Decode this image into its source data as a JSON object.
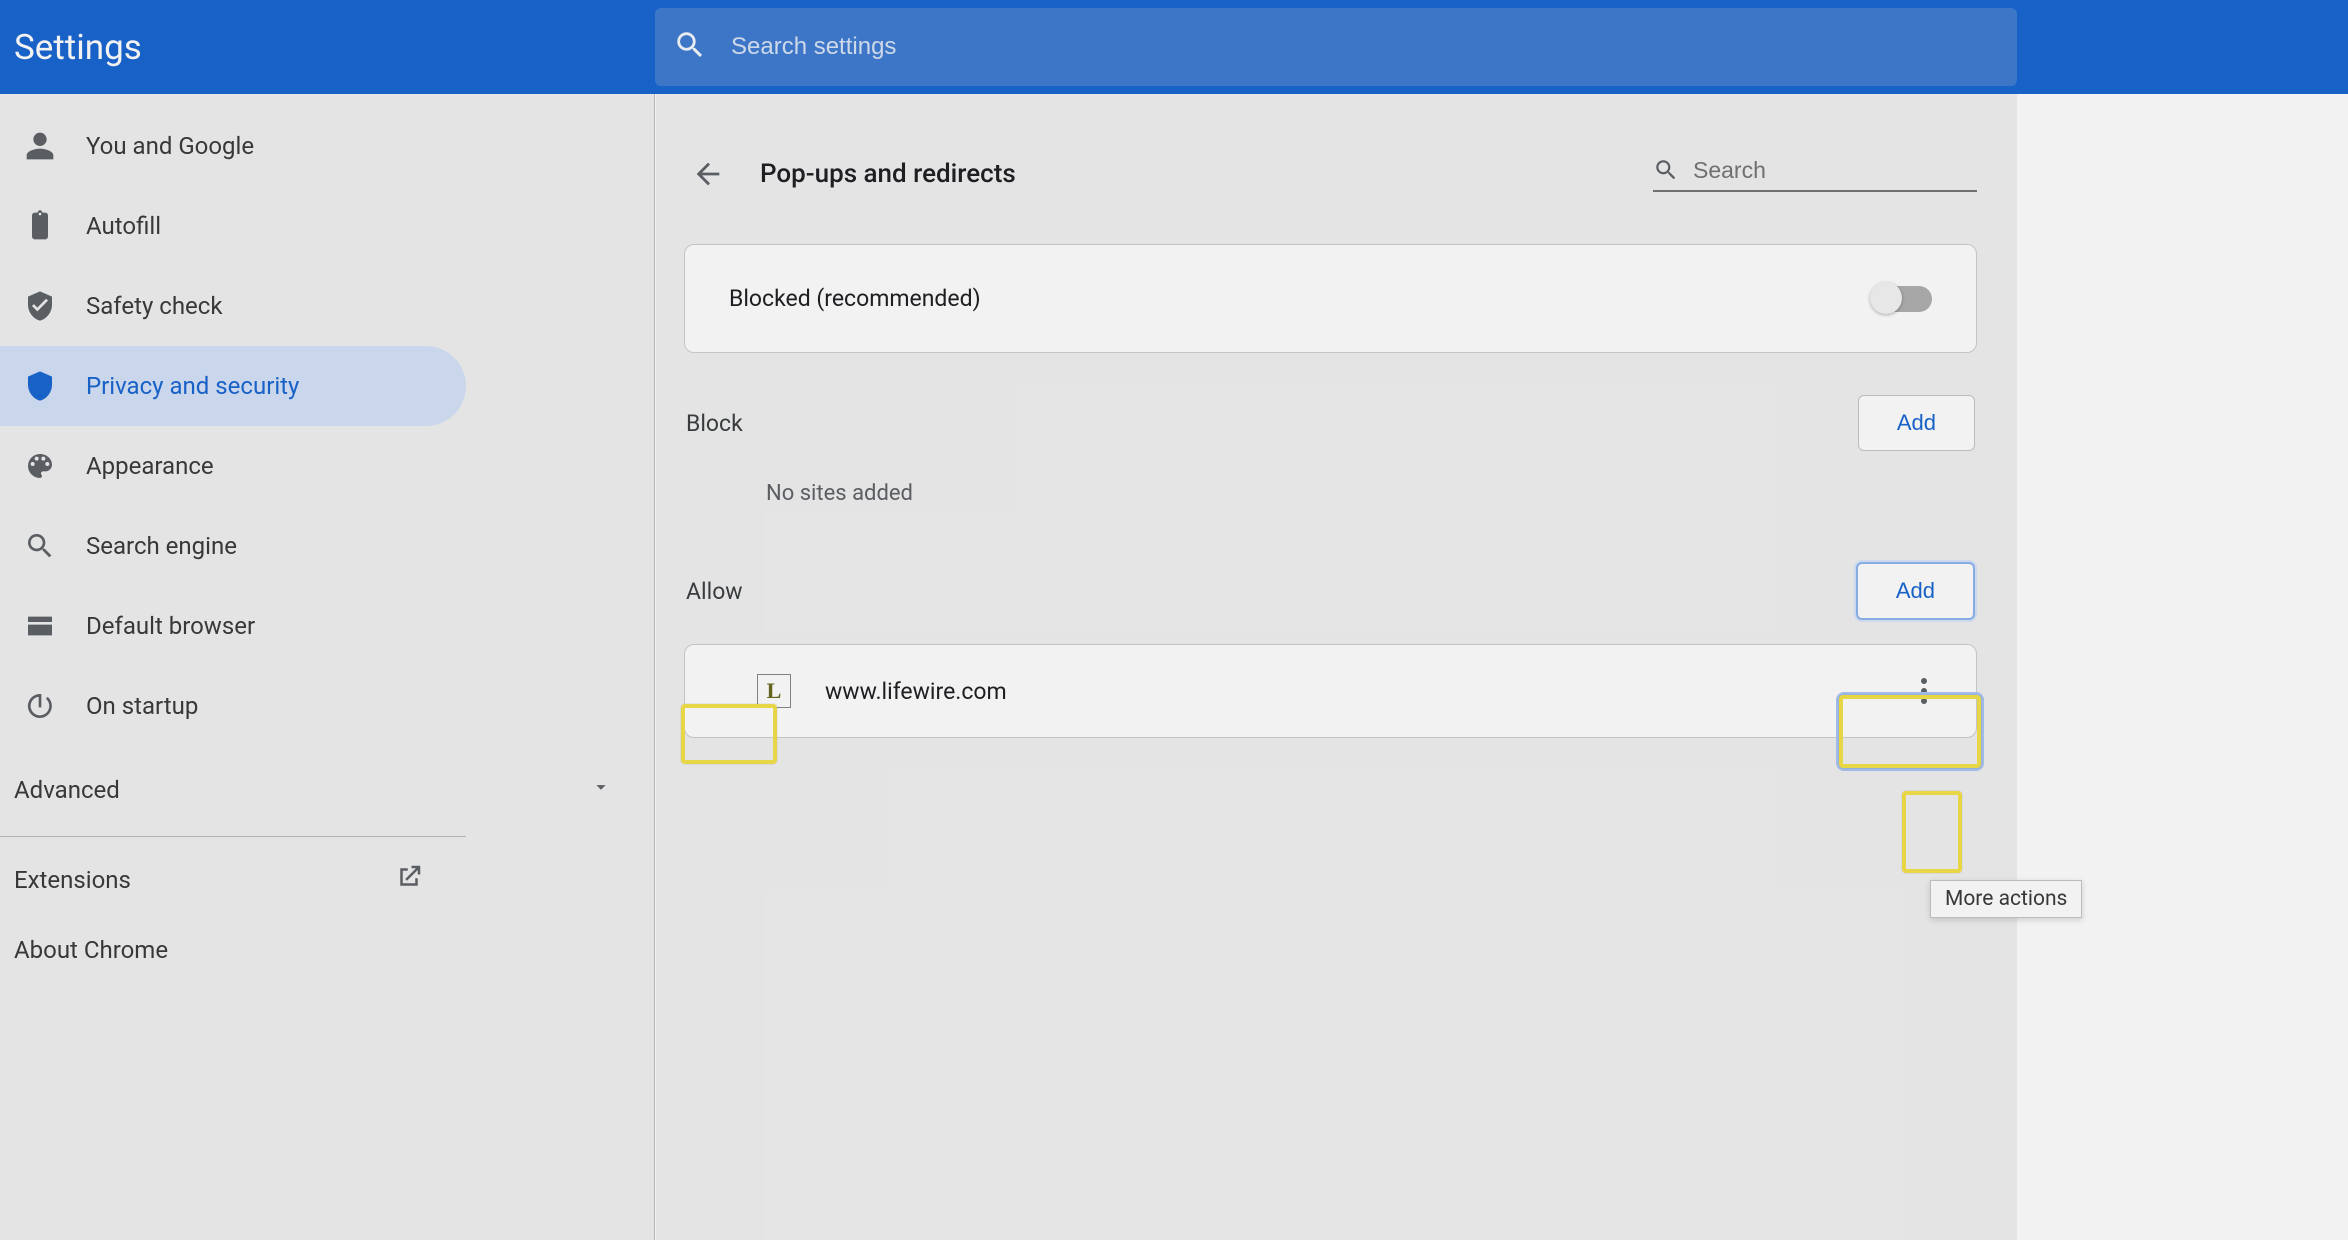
{
  "app_title": "Settings",
  "search_placeholder": "Search settings",
  "sidebar": {
    "items": [
      {
        "icon": "person",
        "label": "You and Google"
      },
      {
        "icon": "clipboard",
        "label": "Autofill"
      },
      {
        "icon": "shield-check",
        "label": "Safety check"
      },
      {
        "icon": "shield",
        "label": "Privacy and security",
        "active": true
      },
      {
        "icon": "palette",
        "label": "Appearance"
      },
      {
        "icon": "search",
        "label": "Search engine"
      },
      {
        "icon": "browser",
        "label": "Default browser"
      },
      {
        "icon": "power",
        "label": "On startup"
      }
    ],
    "advanced": "Advanced",
    "extensions": "Extensions",
    "about": "About Chrome"
  },
  "page": {
    "title": "Pop-ups and redirects",
    "search_placeholder": "Search",
    "blocked_label": "Blocked (recommended)",
    "blocked_state": false,
    "block_section": {
      "title": "Block",
      "add_label": "Add",
      "empty": "No sites added"
    },
    "allow_section": {
      "title": "Allow",
      "add_label": "Add",
      "sites": [
        {
          "favicon": "L",
          "url": "www.lifewire.com"
        }
      ]
    }
  },
  "tooltip": "More actions"
}
